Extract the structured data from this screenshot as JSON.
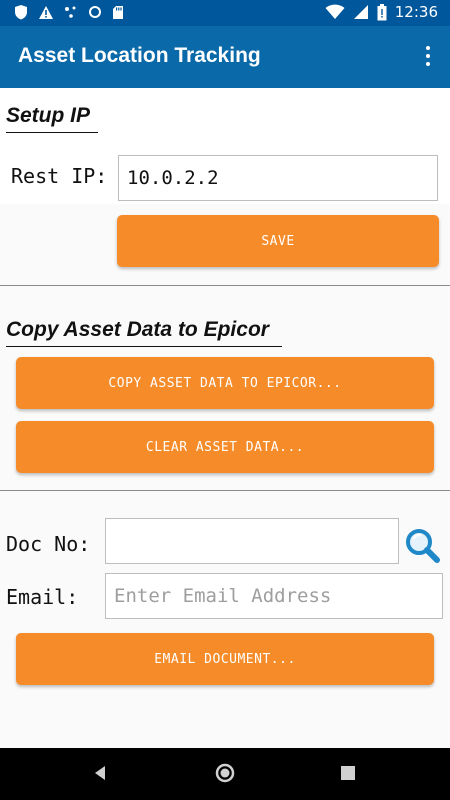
{
  "status_bar": {
    "time": "12:36"
  },
  "app_bar": {
    "title": "Asset Location Tracking"
  },
  "setup": {
    "heading": "Setup IP",
    "rest_ip_label": "Rest IP:",
    "rest_ip_value": "10.0.2.2",
    "save_label": "SAVE"
  },
  "copy": {
    "heading": "Copy Asset Data to Epicor",
    "copy_label": "COPY ASSET DATA TO EPICOR...",
    "clear_label": "CLEAR ASSET DATA..."
  },
  "email": {
    "doc_no_label": "Doc No:",
    "doc_no_value": "",
    "email_label": "Email:",
    "email_placeholder": "Enter Email Address",
    "email_button_label": "EMAIL DOCUMENT..."
  },
  "colors": {
    "status_bar": "#01579b",
    "app_bar": "#0a69a8",
    "button": "#f58b29",
    "search_icon": "#1e88c8"
  },
  "icons": [
    "shield-icon",
    "warning-icon",
    "dots-icon",
    "circle-icon",
    "sd-card-icon",
    "wifi-icon",
    "signal-icon",
    "battery-icon",
    "overflow-menu-icon",
    "search-icon",
    "nav-back-icon",
    "nav-home-icon",
    "nav-recents-icon"
  ]
}
